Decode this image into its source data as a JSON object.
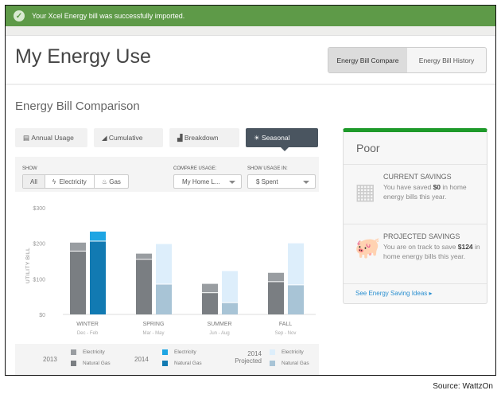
{
  "banner": {
    "message": "Your Xcel Energy bill was successfully imported."
  },
  "header": {
    "title": "My Energy Use",
    "toggle": [
      "Energy Bill Compare",
      "Energy Bill History"
    ],
    "active_toggle": "Energy Bill Compare"
  },
  "section_title": "Energy Bill Comparison",
  "tabs": [
    {
      "label": "Annual Usage",
      "icon": "list-icon"
    },
    {
      "label": "Cumulative",
      "icon": "area-chart-icon"
    },
    {
      "label": "Breakdown",
      "icon": "bar-chart-icon"
    },
    {
      "label": "Seasonal",
      "icon": "sun-icon"
    }
  ],
  "active_tab": "Seasonal",
  "controls": {
    "show_label": "SHOW",
    "show_options": [
      "All",
      "Electricity",
      "Gas"
    ],
    "show_selected": "All",
    "compare_label": "COMPARE USAGE:",
    "compare_value": "My Home L...",
    "usage_in_label": "SHOW USAGE IN:",
    "usage_in_value": "$ Spent"
  },
  "chart_data": {
    "type": "bar",
    "stacked": true,
    "ylabel": "UTILITY BILL",
    "ylim": [
      0,
      300
    ],
    "yticks": [
      "$0",
      "$100",
      "$200",
      "$300"
    ],
    "categories": [
      "WINTER",
      "SPRING",
      "SUMMER",
      "FALL"
    ],
    "category_sub": [
      "Dec - Feb",
      "Mar - May",
      "Jun - Aug",
      "Sep - Nov"
    ],
    "groups": [
      {
        "name": "2013",
        "values": {
          "Natural Gas": [
            177,
            154,
            60,
            91
          ],
          "Electricity": [
            25,
            17,
            26,
            26
          ]
        },
        "colors": {
          "Electricity": "#999da1",
          "Natural Gas": "#7a7e82"
        }
      },
      {
        "name": "2014",
        "values": {
          "Natural Gas": [
            205,
            null,
            null,
            null
          ],
          "Electricity": [
            28,
            null,
            null,
            null
          ]
        },
        "colors": {
          "Electricity": "#1ea5e3",
          "Natural Gas": "#127ab2"
        }
      },
      {
        "name": "2014 Projected",
        "values": {
          "Natural Gas": [
            null,
            84,
            32,
            82
          ],
          "Electricity": [
            null,
            114,
            90,
            118
          ]
        },
        "colors": {
          "Electricity": "#ddeefb",
          "Natural Gas": "#a8c4d6"
        }
      }
    ]
  },
  "legend": {
    "year_2013": "2013",
    "year_2014": "2014",
    "projected_1": "2014",
    "projected_2": "Projected",
    "electricity": "Electricity",
    "gas": "Natural Gas"
  },
  "card": {
    "rating": "Poor",
    "current_title": "CURRENT SAVINGS",
    "current_pre": "You have saved",
    "current_amt": "$0",
    "current_post": "in home energy bills this year.",
    "projected_title": "PROJECTED SAVINGS",
    "projected_pre": "You are on track to save",
    "projected_amt": "$124",
    "projected_post": "in home energy bills this year.",
    "link": "See Energy Saving Ideas"
  },
  "source": "Source: WattzOn"
}
